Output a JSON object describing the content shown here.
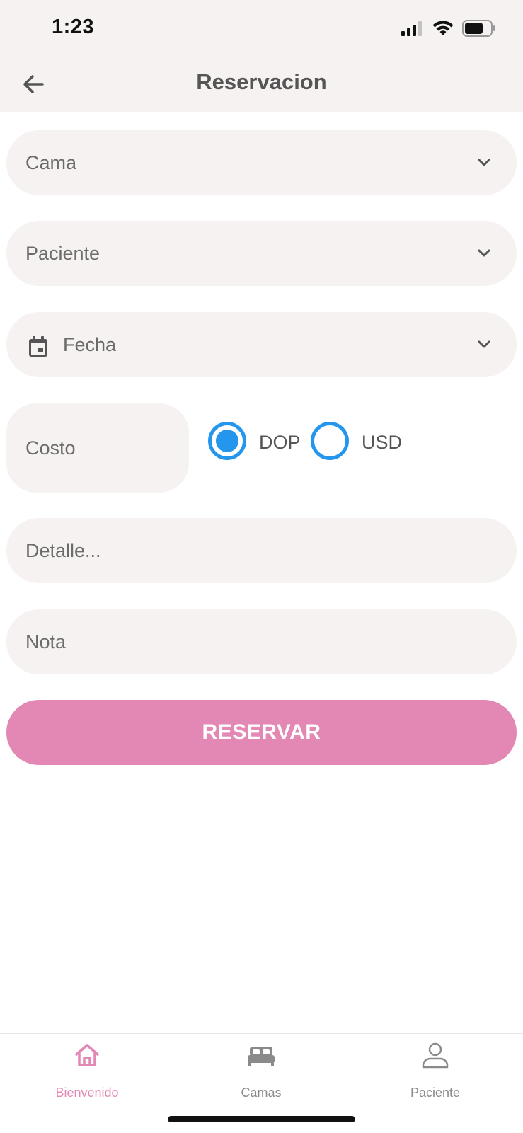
{
  "status_bar": {
    "time": "1:23"
  },
  "header": {
    "title": "Reservacion",
    "back_icon": "arrow-left-icon"
  },
  "form": {
    "cama": {
      "label": "Cama"
    },
    "paciente": {
      "label": "Paciente"
    },
    "fecha": {
      "label": "Fecha",
      "icon": "calendar-icon"
    },
    "costo": {
      "label": "Costo"
    },
    "currency": {
      "options": [
        {
          "label": "DOP",
          "selected": true
        },
        {
          "label": "USD",
          "selected": false
        }
      ]
    },
    "detalle": {
      "label": "Detalle..."
    },
    "nota": {
      "label": "Nota"
    },
    "submit": {
      "label": "RESERVAR"
    }
  },
  "tabbar": {
    "tabs": [
      {
        "label": "Bienvenido",
        "icon": "home-icon",
        "active": true
      },
      {
        "label": "Camas",
        "icon": "bed-icon",
        "active": false
      },
      {
        "label": "Paciente",
        "icon": "person-icon",
        "active": false
      }
    ]
  },
  "colors": {
    "field_bg": "#f6f2f1",
    "accent_pink": "#e387b4",
    "radio_blue": "#2596ee",
    "text_gray": "#555555"
  }
}
